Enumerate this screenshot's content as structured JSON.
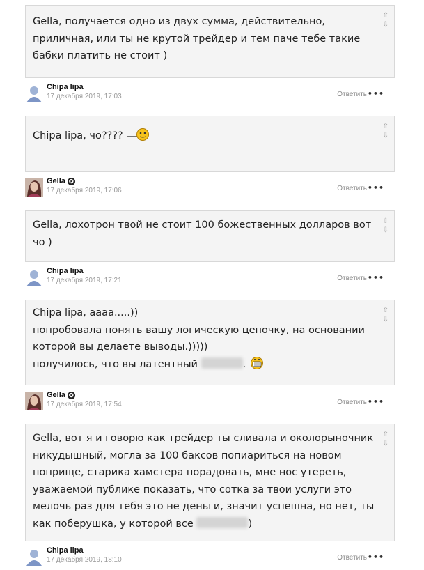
{
  "comments": [
    {
      "lines": [
        "Gella, получается одно из двух сумма, действительно,",
        "приличная, или ты не крутой трейдер и тем паче тебе такие",
        "бабки платить не стоит )"
      ],
      "author": "Chipa lipa",
      "date": "17 декабря 2019, 17:03"
    },
    {
      "text": "Chipa lipa, чо????",
      "author": "Gella",
      "date": "17 декабря 2019, 17:06"
    },
    {
      "lines": [
        "Gella, лохотрон твой не стоит 100 божественных долларов вот",
        "чо )"
      ],
      "author": "Chipa lipa",
      "date": "17 декабря 2019, 17:21"
    },
    {
      "lines": [
        "Chipa lipa, аааа.....))",
        "попробовала понять вашу логическую цепочку, на основании",
        "которой вы делаете выводы.)))))",
        "получилось, что вы латентный"
      ],
      "line_end": ".",
      "author": "Gella",
      "date": "17 декабря 2019, 17:54"
    },
    {
      "lines": [
        "Gella, вот я и говорю как трейдер ты сливала и околорыночник",
        "никудышный, могла за 100 баксов попиариться на новом",
        "поприще, старика хамстера порадовать, мне нос утереть,",
        "уважаемой публике показать, что сотка за твои услуги это",
        "мелочь раз для тебя это не деньги, значит успешна, но нет, ты",
        "как поберушка, у которой все"
      ],
      "line_end": ")",
      "author": "Chipa lipa",
      "date": "17 декабря 2019, 18:10"
    }
  ],
  "ui": {
    "reply_label": "Ответить",
    "more_label": "•••",
    "vote_up": "⇧",
    "vote_down": "⇩",
    "star": "✪"
  }
}
